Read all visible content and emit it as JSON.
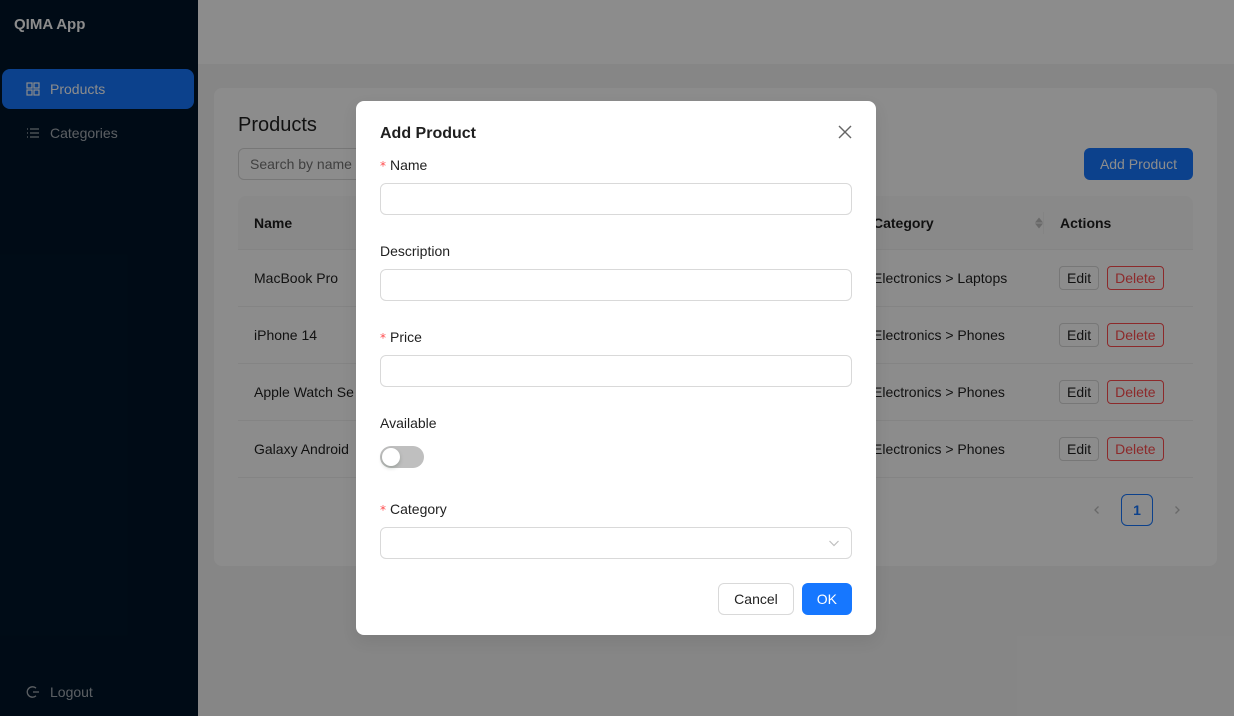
{
  "app": {
    "title": "QIMA App"
  },
  "sidebar": {
    "items": [
      {
        "label": "Products",
        "icon": "grid-icon",
        "active": true
      },
      {
        "label": "Categories",
        "icon": "list-icon",
        "active": false
      }
    ],
    "logout": "Logout"
  },
  "page": {
    "title": "Products",
    "search_placeholder": "Search by name",
    "add_button": "Add Product"
  },
  "table": {
    "columns": {
      "name": "Name",
      "category": "Category",
      "actions": "Actions"
    },
    "rows": [
      {
        "name": "MacBook Pro",
        "category": "Electronics > Laptops"
      },
      {
        "name": "iPhone 14",
        "category": "Electronics > Phones"
      },
      {
        "name": "Apple Watch Se",
        "category": "Electronics > Phones"
      },
      {
        "name": "Galaxy Android",
        "category": "Electronics > Phones"
      }
    ],
    "edit_label": "Edit",
    "delete_label": "Delete"
  },
  "pagination": {
    "current": "1"
  },
  "modal": {
    "title": "Add Product",
    "fields": {
      "name": {
        "label": "Name",
        "value": ""
      },
      "description": {
        "label": "Description",
        "value": ""
      },
      "price": {
        "label": "Price",
        "value": ""
      },
      "available": {
        "label": "Available",
        "on": false
      },
      "category": {
        "label": "Category",
        "value": ""
      }
    },
    "cancel": "Cancel",
    "ok": "OK"
  },
  "colors": {
    "primary": "#1677ff",
    "danger": "#ff4d4f",
    "sidebar": "#001529"
  }
}
